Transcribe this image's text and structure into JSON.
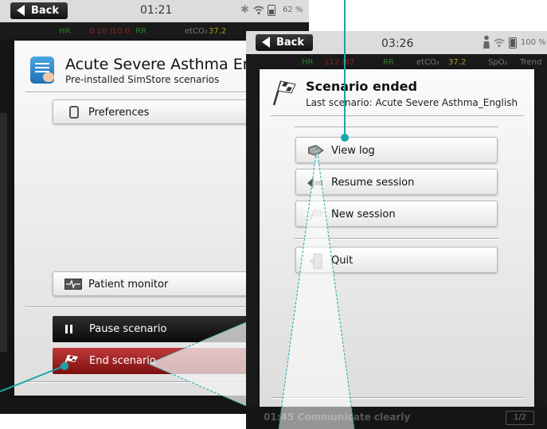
{
  "colors": {
    "callout": "#1aa6a6",
    "end_scenario": "#a82222",
    "hr_red": "#c0392b"
  },
  "left_screen": {
    "status": {
      "back": "Back",
      "time": "01:21",
      "battery": "62 %",
      "icons": [
        "bluetooth-icon",
        "wifi-icon",
        "battery-icon"
      ]
    },
    "vitals": {
      "hr": "HR",
      "hr_val": "0.10 /10.0",
      "rr": "RR",
      "etco2": "etCO₂",
      "etco2_val": "37.2"
    },
    "app_title": "Acute Severe Asthma Engl",
    "app_subtitle": "Pre-installed SimStore scenarios",
    "buttons": {
      "preferences": "Preferences",
      "patient_monitor": "Patient monitor",
      "pause": "Pause scenario",
      "end": "End scenario"
    }
  },
  "right_screen": {
    "status": {
      "back": "Back",
      "time": "03:26",
      "battery": "100 %",
      "icons": [
        "person-icon",
        "wifi-icon",
        "battery-icon"
      ]
    },
    "vitals": {
      "hr": "HR",
      "hr_val": "112 /87",
      "rr": "RR",
      "etco2": "etCO₂",
      "etco2_val": "37.2",
      "spo2": "SpO₂",
      "trend": "Trend"
    },
    "title": "Scenario ended",
    "subtitle": "Last scenario: Acute Severe Asthma_English",
    "buttons": {
      "view_log": "View log",
      "resume": "Resume session",
      "new_session": "New session",
      "quit": "Quit"
    },
    "footer": "01:45 Communicate clearly",
    "footer_badge": "1/2"
  }
}
